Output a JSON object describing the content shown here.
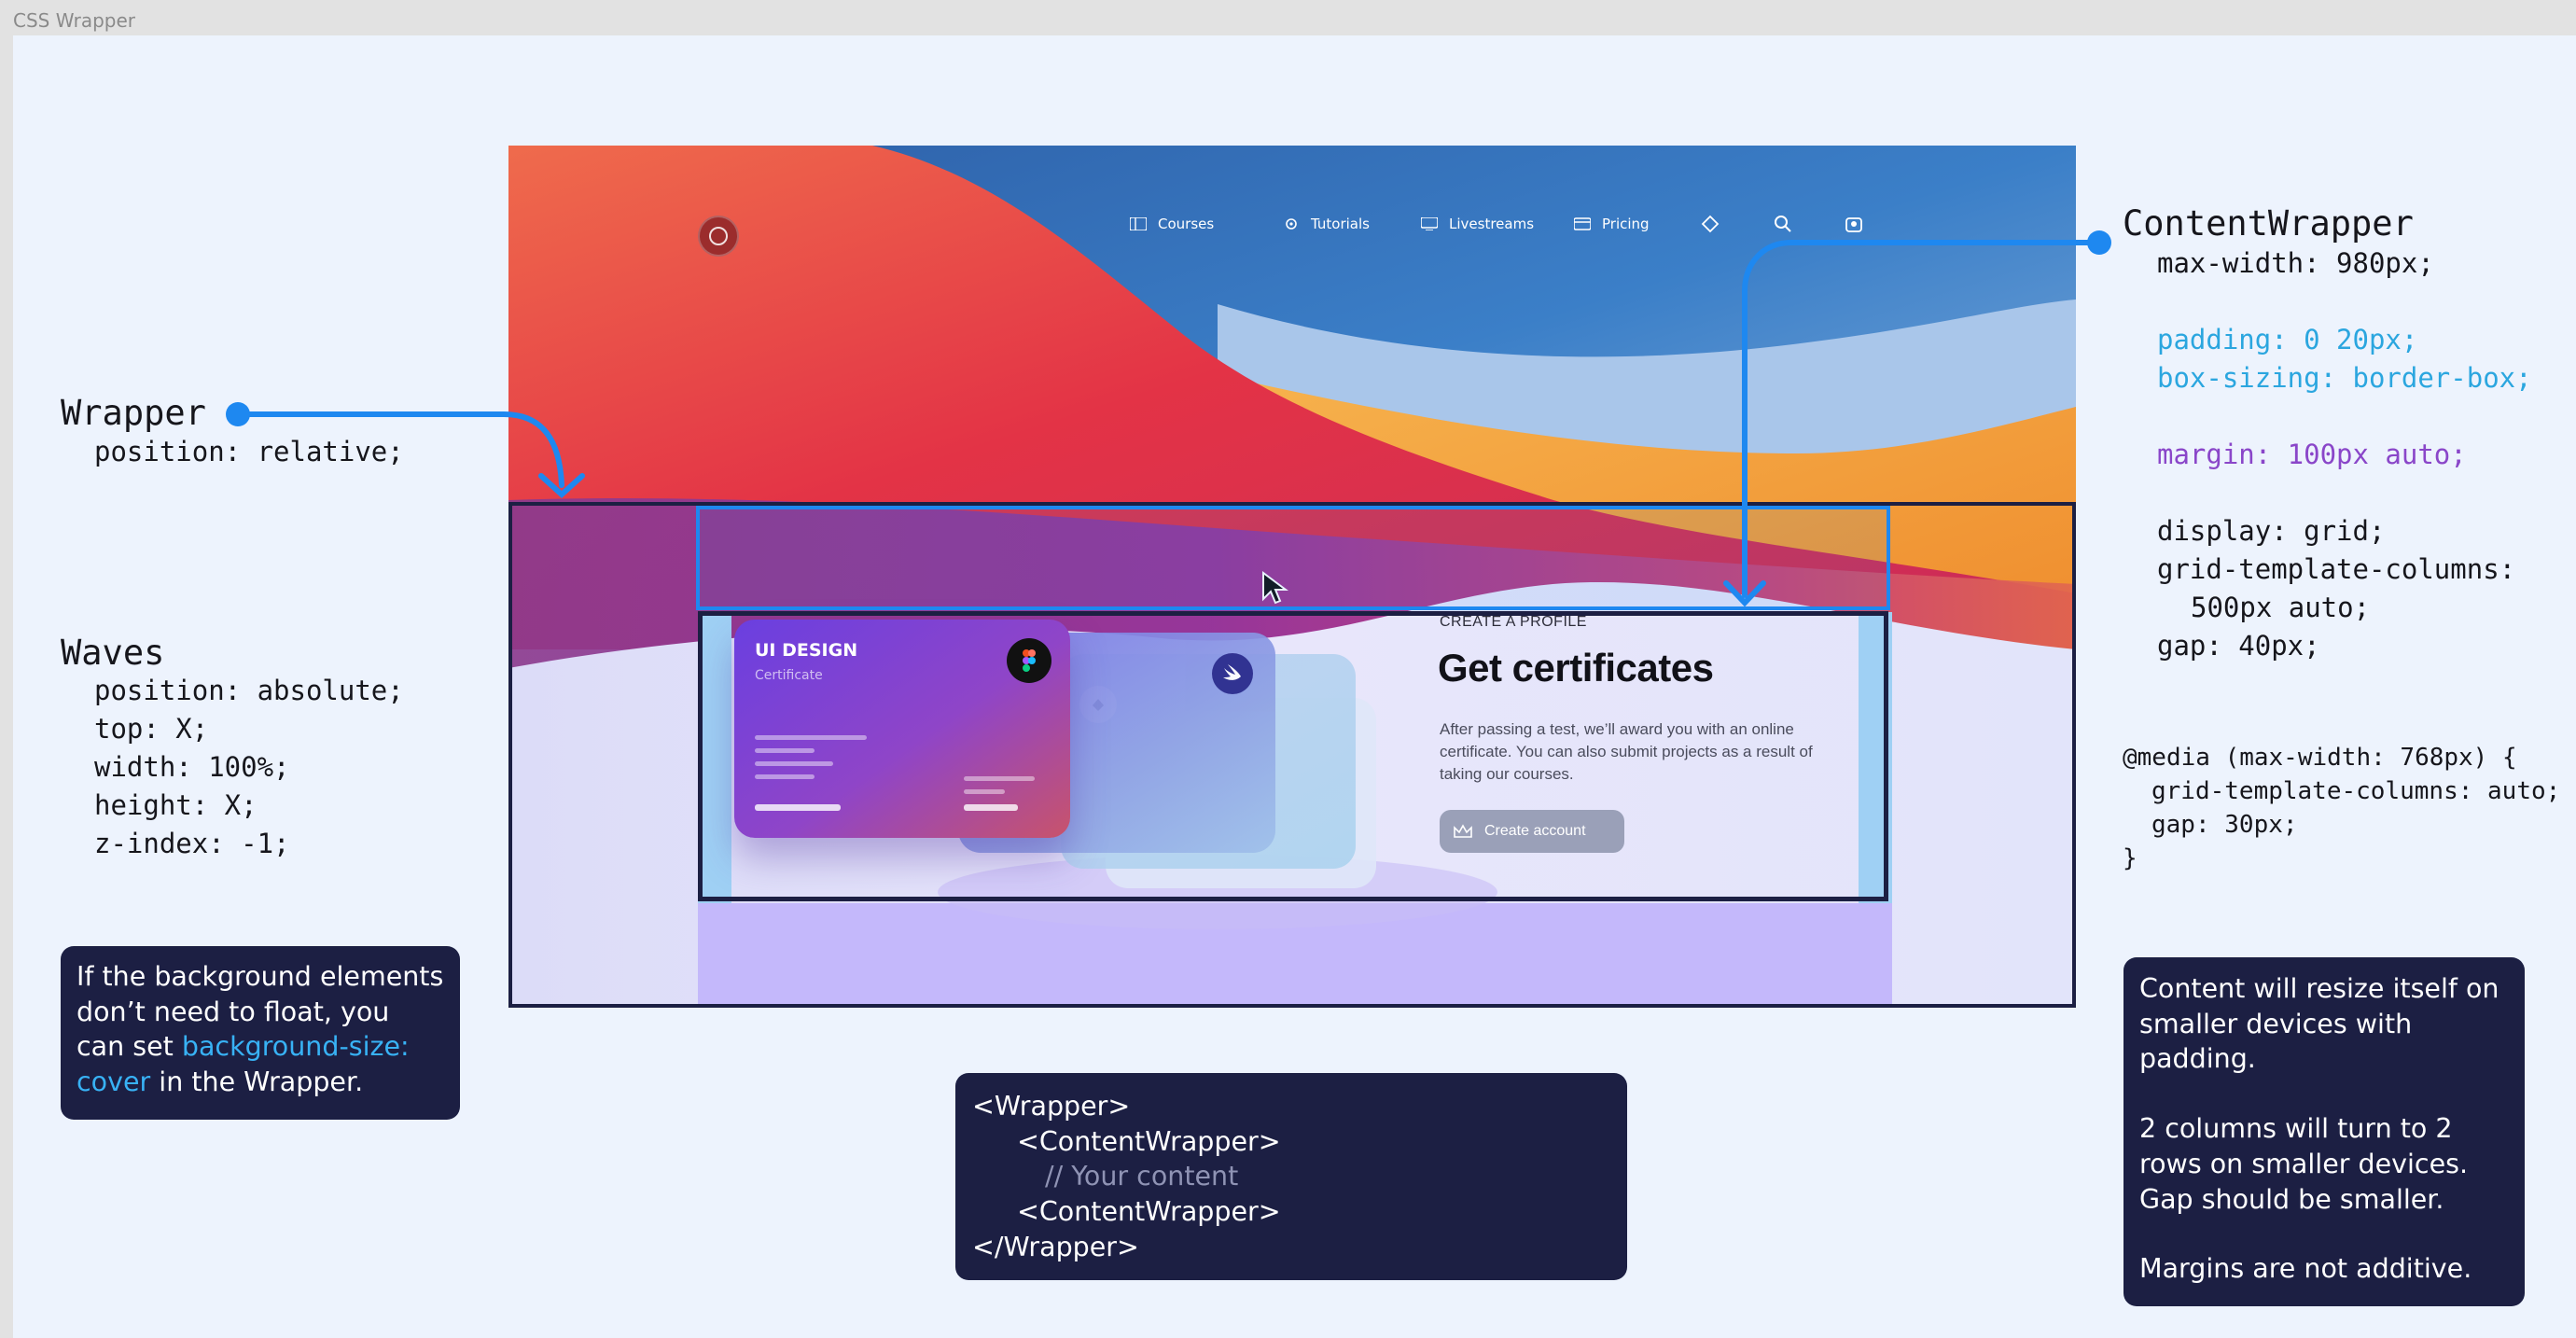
{
  "window": {
    "title": "CSS Wrapper"
  },
  "wrapper_label": {
    "title": "Wrapper",
    "lines": [
      "position: relative;"
    ]
  },
  "waves_label": {
    "title": "Waves",
    "lines": [
      "position: absolute;",
      "top: X;",
      "width: 100%;",
      "height: X;",
      "z-index: -1;"
    ]
  },
  "content_wrapper_label": {
    "title": "ContentWrapper",
    "max_width": "max-width: 980px;",
    "padding": "padding: 0 20px;",
    "box_sizing": "box-sizing: border-box;",
    "margin": "margin: 100px auto;",
    "display": "display: grid;",
    "grid_columns": "grid-template-columns:",
    "grid_columns_value": "500px auto;",
    "gap": "gap: 40px;"
  },
  "media_query": {
    "open": "@media (max-width: 768px) {",
    "columns": "grid-template-columns: auto;",
    "gap": "gap: 30px;",
    "close": "}"
  },
  "note_background": {
    "text_before": "If the background elements don’t need to float, you can set ",
    "highlight": "background-size: cover",
    "text_after": " in the Wrapper."
  },
  "note_structure": {
    "line1": "<Wrapper>",
    "line2": "<ContentWrapper>",
    "line3": "// Your content",
    "line4": "<ContentWrapper>",
    "line5": "</Wrapper>"
  },
  "note_responsive": {
    "para1": "Content will resize itself on smaller devices with padding.",
    "para2": "2 columns will turn to 2 rows on smaller devices. Gap should be smaller.",
    "para3": "Margins are not additive."
  },
  "mockup": {
    "nav": {
      "courses": "Courses",
      "tutorials": "Tutorials",
      "livestreams": "Livestreams",
      "pricing": "Pricing"
    },
    "card": {
      "title": "UI DESIGN",
      "subtitle": "Certificate"
    },
    "eyebrow": "CREATE A PROFILE",
    "headline": "Get certificates",
    "description": "After passing a test, we’ll award you with an online certificate. You can also submit projects as a result of taking our courses.",
    "cta": "Create account"
  },
  "colors": {
    "accent_blue": "#1e88f0",
    "navy": "#1c1f43",
    "highlight_blue": "#38b2f5",
    "code_blue": "#2ba6df",
    "code_purple": "#8a46c9"
  }
}
